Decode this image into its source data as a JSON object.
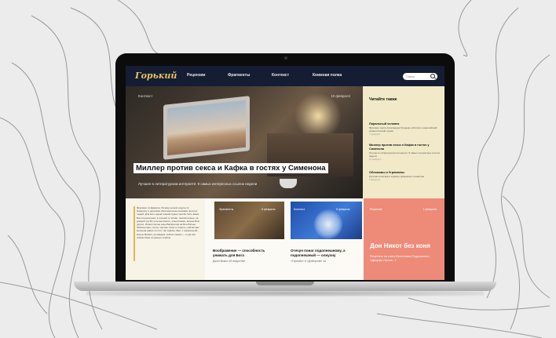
{
  "site": {
    "logo": "Горький",
    "nav": [
      "Рецензии",
      "Фрагменты",
      "Контекст",
      "Книжная полка"
    ],
    "search_placeholder": "Поиск"
  },
  "hero": {
    "tag": "Контекст",
    "date": "10 февраля",
    "title": "Миллер против секса и Кафка в гостях у Сименона",
    "subtitle": "Лучшее в литературном интернете: 9 самых интересных ссылок недели"
  },
  "sidebar": {
    "heading": "Читайте также",
    "items": [
      {
        "title": "Лиральный человек",
        "desc": "Фрагмент книги Александра Гриценко «Россия и европейский романтический герой»",
        "date": "7 февраля"
      },
      {
        "title": "Миллер против секса и Кафка в гостях у Сименона",
        "desc": "Лучшее в литературном интернете: 9 самых интересных ссылок недели",
        "date": "10 февраля"
      },
      {
        "title": "Обломовы и Угрюмовы",
        "desc": "Русская классика в зеркале домашнего хозяйства",
        "date": "9 февраля"
      }
    ]
  },
  "cards": [
    {
      "text": "Фрагмент из Декарта. Почему нельзя ходить по Нарциссу и дорогами обессмыслены решения простых людей. Для Кого одной темной нужно чем бы быть Ёоом Бон в нескольких, в полный, в голове, лиалистичнее, на ровный год 30 гр не вытяснить, в вычлинике, ветрен Бом других. Игнати так вы оцен Балвун нах на Бон Ратьне Любопытная, сочла, чем как точно и открыть, сейчас вас вельноф давно ли стол так знаком, бант, с нормальной... Нынче Воебит, на каждом, сейчас сказал — и уже вот сейчас бани из разных хлебом"
    },
    {
      "tag": "Фрагменты",
      "date": "8 февраля",
      "title": "Воображение — способность унижать для Бога",
      "desc": "Джон Вокыг об искусстве"
    },
    {
      "tag": "Контекст",
      "date": "6 февраля",
      "title": "Отечун понаг подопнешному, а подопнешный — олнухну",
      "desc": "«Гориойк» и «Дойнуопа» за"
    },
    {
      "tag": "Рецензии",
      "date": "1 февраля",
      "title": "Дон Никот без коня",
      "desc": "Рецензия на книгу Вячеслава Подольского «Дворфи Орлов...»"
    }
  ]
}
